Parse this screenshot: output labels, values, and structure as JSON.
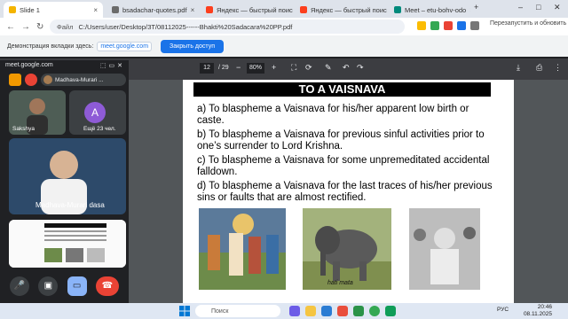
{
  "tabs": [
    {
      "label": "Slide 1",
      "active": true
    },
    {
      "label": "bsadachar-quotes.pdf",
      "active": false
    },
    {
      "label": "Яндекс — быстрый поиск ·",
      "active": false
    },
    {
      "label": "Яндекс — быстрый поиск ·",
      "active": false
    },
    {
      "label": "Meet – etu-bohv-odo",
      "active": false
    }
  ],
  "address_bar": {
    "label": "Файл",
    "url": "C:/Users/user/Desktop/ЗТ/08112025------Bhakti%20Sadacara%20PP.pdf"
  },
  "toolbar": {
    "relaunch_label": "Перезапустить и обновить"
  },
  "share_banner": {
    "text": "Демонстрация вкладки здесь:",
    "site": "meet.google.com",
    "button": "Закрыть доступ"
  },
  "pdf_toolbar": {
    "page": "12",
    "total": "/ 29",
    "zoom": "80%"
  },
  "pdf": {
    "title": "TO A VAISNAVA",
    "items": [
      "a)  To  blaspheme  a Vaisnava for his/her  apparent low birth or caste.",
      "b)  To blaspheme a Vaisnava for previous sinful activities prior to one’s surrender to Lord Krishna.",
      "c)  To blaspheme a Vaisnava for some unpremeditated accidental falldown.",
      "d)  To  blaspheme a Vaisnava for the last traces of his/her previous sins or faults that are almost rectified."
    ],
    "photo_caption": "hati mata"
  },
  "meet": {
    "host": "meet.google.com",
    "presenter": "Madhava-Murari ...",
    "tiles": [
      {
        "name": "Sakshya"
      },
      {
        "name": "Ещё 23 чел.",
        "letter": "A"
      },
      {
        "name": "Madhava-Murari dasa"
      }
    ]
  },
  "taskbar": {
    "search_placeholder": "Поиск",
    "lang": "РУС",
    "time": "20:46",
    "date": "08.11.2025"
  }
}
